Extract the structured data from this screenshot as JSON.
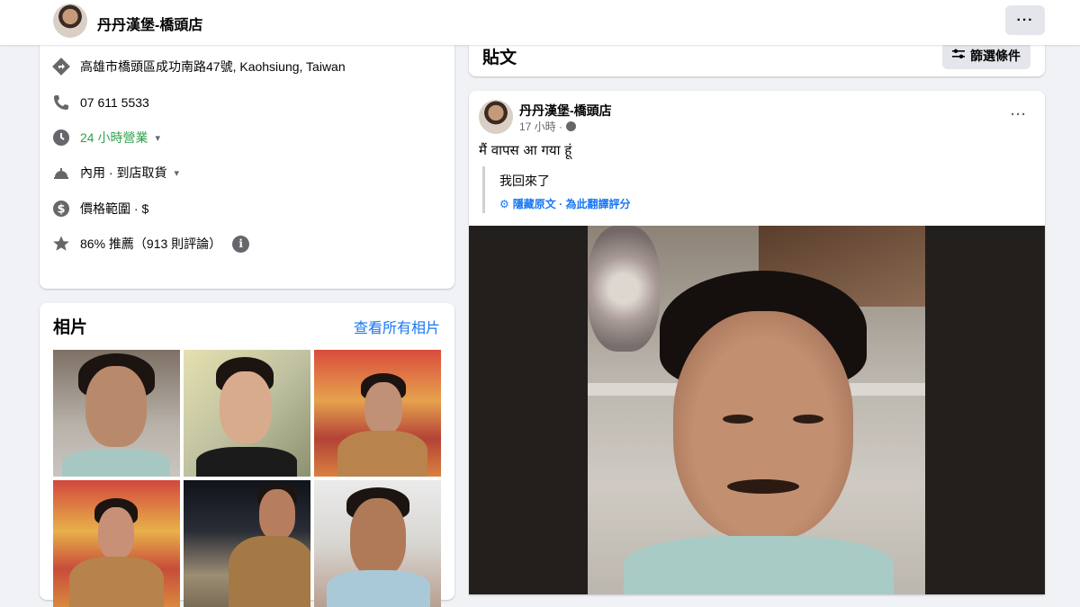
{
  "header": {
    "page_name": "丹丹漢堡-橋頭店",
    "more_label": "···"
  },
  "info": {
    "address": "高雄市橋頭區成功南路47號, Kaohsiung, Taiwan",
    "phone": "07 611 5533",
    "hours": "24 小時營業",
    "services": "內用 · 到店取貨",
    "price_range": "價格範圍 · $",
    "rating": "86% 推薦（913 則評論）",
    "info_badge": "i"
  },
  "photos": {
    "title": "相片",
    "see_all": "查看所有相片"
  },
  "posts": {
    "title": "貼文",
    "filter_label": "篩選條件",
    "post": {
      "author": "丹丹漢堡-橋頭店",
      "time": "17 小時 ·",
      "more_label": "···",
      "text": "मैं वापस आ गया हूं",
      "translation": "我回來了",
      "hide_original": "隱藏原文",
      "separator": " · ",
      "rate_translation": "為此翻譯評分"
    }
  },
  "icons": {
    "address": "directions-icon",
    "phone": "phone-icon",
    "hours": "clock-icon",
    "services": "service-bell-icon",
    "price": "dollar-icon",
    "rating": "star-icon"
  }
}
